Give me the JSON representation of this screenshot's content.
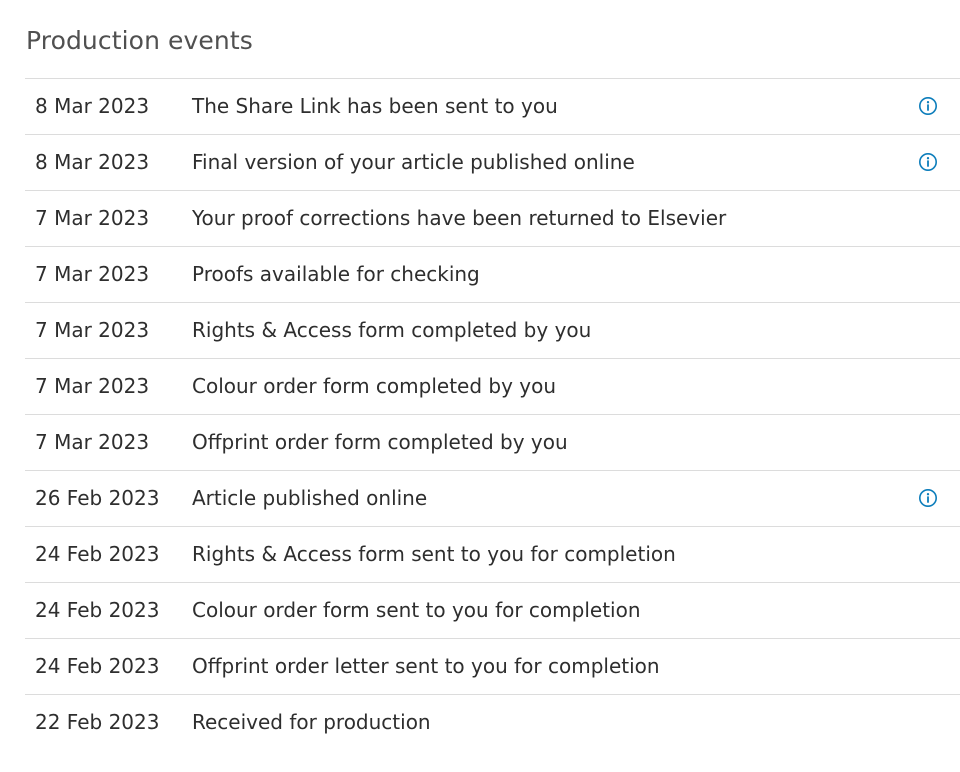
{
  "section": {
    "title": "Production events"
  },
  "colors": {
    "text": "#2e2e2e",
    "title": "#505050",
    "divider": "#dcdcdc",
    "info_icon": "#0c7dbb"
  },
  "events": [
    {
      "date": "8 Mar 2023",
      "description": "The Share Link has been sent to you",
      "info": true,
      "icon": "info-icon"
    },
    {
      "date": "8 Mar 2023",
      "description": "Final version of your article published online",
      "info": true,
      "icon": "info-icon"
    },
    {
      "date": "7 Mar 2023",
      "description": "Your proof corrections have been returned to Elsevier",
      "info": false
    },
    {
      "date": "7 Mar 2023",
      "description": "Proofs available for checking",
      "info": false
    },
    {
      "date": "7 Mar 2023",
      "description": "Rights & Access form completed by you",
      "info": false
    },
    {
      "date": "7 Mar 2023",
      "description": "Colour order form completed by you",
      "info": false
    },
    {
      "date": "7 Mar 2023",
      "description": "Offprint order form completed by you",
      "info": false
    },
    {
      "date": "26 Feb 2023",
      "description": "Article published online",
      "info": true,
      "icon": "info-icon"
    },
    {
      "date": "24 Feb 2023",
      "description": "Rights & Access form sent to you for completion",
      "info": false
    },
    {
      "date": "24 Feb 2023",
      "description": "Colour order form sent to you for completion",
      "info": false
    },
    {
      "date": "24 Feb 2023",
      "description": "Offprint order letter sent to you for completion",
      "info": false
    },
    {
      "date": "22 Feb 2023",
      "description": "Received for production",
      "info": false
    }
  ]
}
